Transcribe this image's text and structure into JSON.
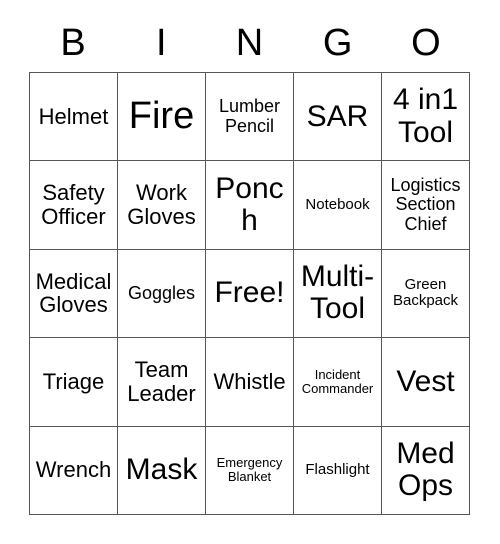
{
  "card": {
    "header_letters": [
      "B",
      "I",
      "N",
      "G",
      "O"
    ],
    "grid": {
      "rows": 5,
      "columns": 5,
      "border_color": "#555555",
      "background_color": "#ffffff",
      "text_color": "#000000",
      "cells": [
        {
          "label": "Helmet",
          "size": "md",
          "row": 1,
          "col": 1
        },
        {
          "label": "Fire",
          "size": "xl",
          "row": 1,
          "col": 2
        },
        {
          "label": "Lumber Pencil",
          "size": "sm",
          "row": 1,
          "col": 3
        },
        {
          "label": "SAR",
          "size": "lg",
          "row": 1,
          "col": 4
        },
        {
          "label": "4 in1 Tool",
          "size": "lg",
          "row": 1,
          "col": 5
        },
        {
          "label": "Safety Officer",
          "size": "md",
          "row": 2,
          "col": 1
        },
        {
          "label": "Work Gloves",
          "size": "md",
          "row": 2,
          "col": 2
        },
        {
          "label": "Ponch",
          "size": "lg",
          "row": 2,
          "col": 3
        },
        {
          "label": "Notebook",
          "size": "xs",
          "row": 2,
          "col": 4
        },
        {
          "label": "Logistics Section Chief",
          "size": "sm",
          "row": 2,
          "col": 5
        },
        {
          "label": "Medical Gloves",
          "size": "md",
          "row": 3,
          "col": 1
        },
        {
          "label": "Goggles",
          "size": "sm",
          "row": 3,
          "col": 2
        },
        {
          "label": "Free!",
          "size": "lg",
          "row": 3,
          "col": 3
        },
        {
          "label": "Multi-Tool",
          "size": "lg",
          "row": 3,
          "col": 4
        },
        {
          "label": "Green Backpack",
          "size": "xs",
          "row": 3,
          "col": 5
        },
        {
          "label": "Triage",
          "size": "md",
          "row": 4,
          "col": 1
        },
        {
          "label": "Team Leader",
          "size": "md",
          "row": 4,
          "col": 2
        },
        {
          "label": "Whistle",
          "size": "md",
          "row": 4,
          "col": 3
        },
        {
          "label": "Incident Commander",
          "size": "xxs",
          "row": 4,
          "col": 4
        },
        {
          "label": "Vest",
          "size": "lg",
          "row": 4,
          "col": 5
        },
        {
          "label": "Wrench",
          "size": "md",
          "row": 5,
          "col": 1
        },
        {
          "label": "Mask",
          "size": "lg",
          "row": 5,
          "col": 2
        },
        {
          "label": "Emergency Blanket",
          "size": "xxs",
          "row": 5,
          "col": 3
        },
        {
          "label": "Flashlight",
          "size": "xs",
          "row": 5,
          "col": 4
        },
        {
          "label": "Med Ops",
          "size": "lg",
          "row": 5,
          "col": 5
        }
      ]
    }
  }
}
